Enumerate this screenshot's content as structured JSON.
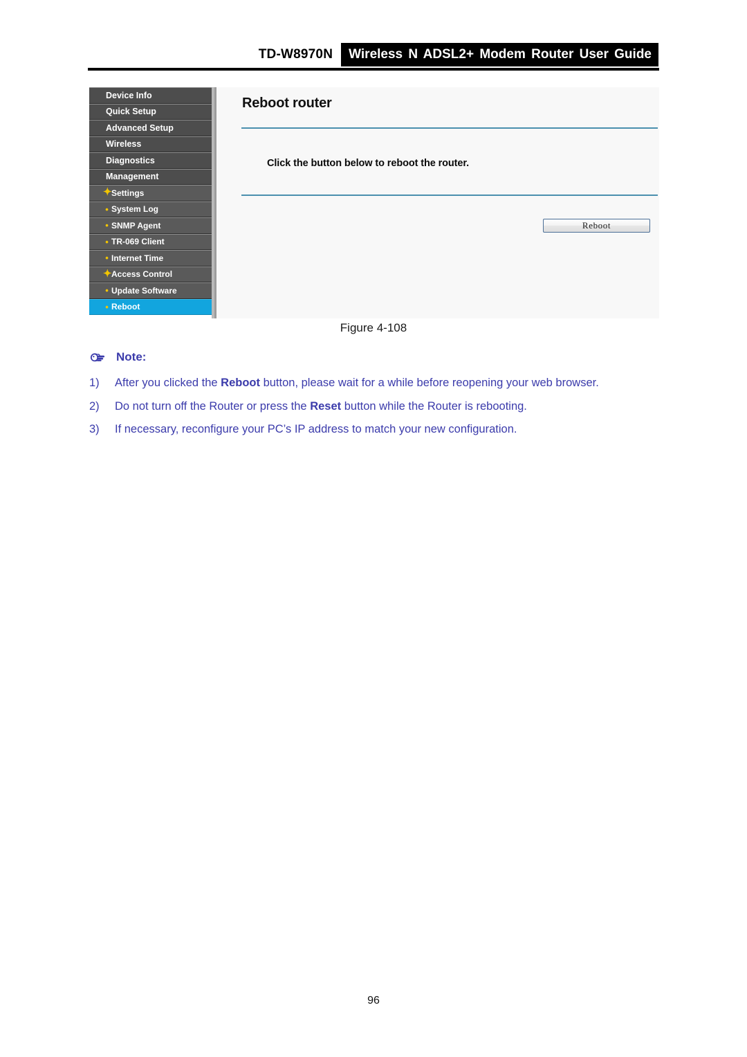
{
  "header": {
    "model": "TD-W8970N",
    "title": "Wireless N ADSL2+ Modem Router User Guide"
  },
  "router_ui": {
    "sidebar": {
      "items": [
        {
          "label": "Device Info",
          "bullet": "none",
          "level": "top",
          "selected": false
        },
        {
          "label": "Quick Setup",
          "bullet": "none",
          "level": "top",
          "selected": false
        },
        {
          "label": "Advanced Setup",
          "bullet": "none",
          "level": "top",
          "selected": false
        },
        {
          "label": "Wireless",
          "bullet": "none",
          "level": "top",
          "selected": false
        },
        {
          "label": "Diagnostics",
          "bullet": "none",
          "level": "top",
          "selected": false
        },
        {
          "label": "Management",
          "bullet": "none",
          "level": "top",
          "selected": false
        },
        {
          "label": "Settings",
          "bullet": "star",
          "level": "sub",
          "selected": false
        },
        {
          "label": "System Log",
          "bullet": "dot",
          "level": "sub",
          "selected": false
        },
        {
          "label": "SNMP Agent",
          "bullet": "dot",
          "level": "sub",
          "selected": false
        },
        {
          "label": "TR-069 Client",
          "bullet": "dot",
          "level": "sub",
          "selected": false
        },
        {
          "label": "Internet Time",
          "bullet": "dot",
          "level": "sub",
          "selected": false
        },
        {
          "label": "Access Control",
          "bullet": "star",
          "level": "sub",
          "selected": false
        },
        {
          "label": "Update Software",
          "bullet": "dot",
          "level": "sub",
          "selected": false
        },
        {
          "label": "Reboot",
          "bullet": "dot",
          "level": "sub",
          "selected": true
        }
      ],
      "selected_color": "#12a5de",
      "item_color": "#4d4d4d",
      "bullet_color": "#f2c500"
    },
    "panel": {
      "title": "Reboot router",
      "instruction": "Click the button below to reboot the router.",
      "reboot_button": "Reboot",
      "rule_color": "#4a8fae"
    }
  },
  "figure": {
    "caption": "Figure 4-108"
  },
  "note": {
    "heading": "Note:",
    "icon": "pointing-hand-icon",
    "color": "#3b3bab",
    "items": [
      {
        "number": "1)",
        "before": "After you clicked the ",
        "bold": "Reboot",
        "after": " button, please wait for a while before reopening your web browser.",
        "justified": true
      },
      {
        "number": "2)",
        "before": "Do not turn off the Router or press the ",
        "bold": "Reset",
        "after": " button while the Router is rebooting.",
        "justified": false
      },
      {
        "number": "3)",
        "before": "If necessary, reconfigure your PC’s IP address to match your new configuration.",
        "bold": "",
        "after": "",
        "justified": false
      }
    ]
  },
  "footer": {
    "page_number": "96"
  }
}
